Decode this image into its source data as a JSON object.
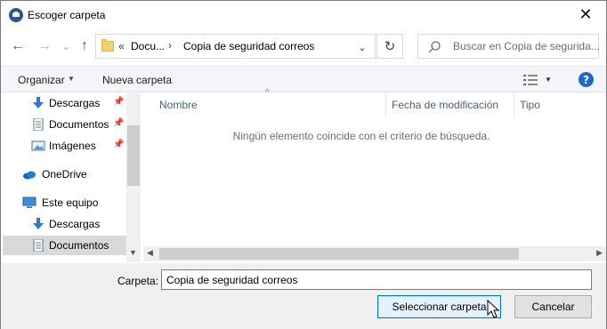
{
  "window": {
    "title": "Escoger carpeta",
    "close_glyph": "✕"
  },
  "toolbar": {
    "back_glyph": "←",
    "forward_glyph": "→",
    "recent_glyph": "⌄",
    "up_glyph": "↑",
    "breadcrumb_overflow": "«",
    "breadcrumbs": [
      "Docu...",
      "Copia de seguridad correos"
    ],
    "breadcrumb_separator": "›",
    "address_dropdown_glyph": "⌄",
    "refresh_glyph": "↻",
    "search_placeholder": "Buscar en Copia de segurida..."
  },
  "commands": {
    "organize": "Organizar",
    "organize_arrow": "▼",
    "new_folder": "Nueva carpeta",
    "view_arrow": "▼",
    "help": "?"
  },
  "nav_pane": {
    "items": [
      {
        "label": "Descargas",
        "icon": "download-icon",
        "pinned": true,
        "indent": 1,
        "selected": false
      },
      {
        "label": "Documentos",
        "icon": "document-icon",
        "pinned": true,
        "indent": 1,
        "selected": false
      },
      {
        "label": "Imágenes",
        "icon": "pictures-icon",
        "pinned": true,
        "indent": 1,
        "selected": false
      },
      {
        "label": "OneDrive",
        "icon": "onedrive-icon",
        "pinned": false,
        "indent": 0,
        "selected": false
      },
      {
        "label": "Este equipo",
        "icon": "computer-icon",
        "pinned": false,
        "indent": 0,
        "selected": false
      },
      {
        "label": "Descargas",
        "icon": "download-icon",
        "pinned": false,
        "indent": 1,
        "selected": false
      },
      {
        "label": "Documentos",
        "icon": "document-icon",
        "pinned": false,
        "indent": 1,
        "selected": true
      }
    ],
    "pin_glyph": "📌"
  },
  "content": {
    "columns": [
      "Nombre",
      "Fecha de modificación",
      "Tipo"
    ],
    "empty_message": "Ningún elemento coincide con el criterio de búsqueda.",
    "sort_caret": "^"
  },
  "footer": {
    "folder_label": "Carpeta:",
    "folder_value": "Copia de seguridad correos",
    "select_button": "Seleccionar carpeta",
    "cancel_button": "Cancelar"
  },
  "colors": {
    "accent": "#0078d7",
    "help": "#1f68c6",
    "selected_item": "#d9d9d9",
    "command_bar": "#f3f5f8",
    "footer": "#f0f0f0"
  }
}
